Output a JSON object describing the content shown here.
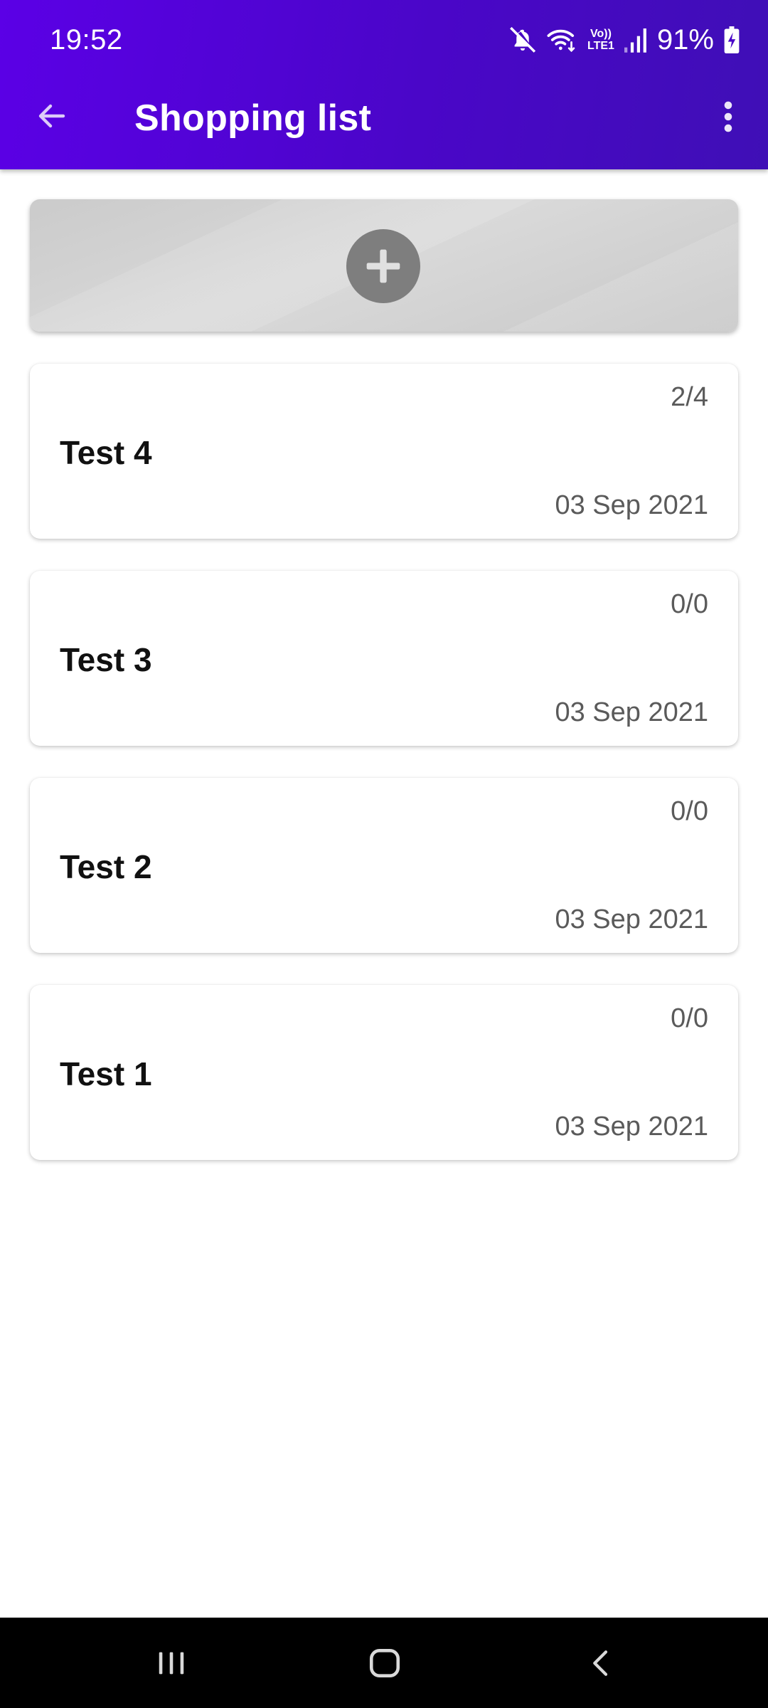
{
  "status_bar": {
    "time": "19:52",
    "battery_percent": "91%",
    "icons": [
      "mute-icon",
      "wifi-icon",
      "volte-icon",
      "signal-icon",
      "battery-charging-icon"
    ],
    "volte_label_top": "Vo))",
    "volte_label_bottom": "LTE1"
  },
  "app_bar": {
    "title": "Shopping list",
    "back_icon": "arrow-back-icon",
    "menu_icon": "more-vert-icon",
    "background": "#4f05d2"
  },
  "add_card": {
    "icon": "plus-icon"
  },
  "lists": [
    {
      "name": "Test 4",
      "count": "2/4",
      "date": "03 Sep 2021"
    },
    {
      "name": "Test 3",
      "count": "0/0",
      "date": "03 Sep 2021"
    },
    {
      "name": "Test 2",
      "count": "0/0",
      "date": "03 Sep 2021"
    },
    {
      "name": "Test 1",
      "count": "0/0",
      "date": "03 Sep 2021"
    }
  ],
  "nav_bar": {
    "icons": [
      "recents-icon",
      "home-icon",
      "nav-back-icon"
    ]
  }
}
